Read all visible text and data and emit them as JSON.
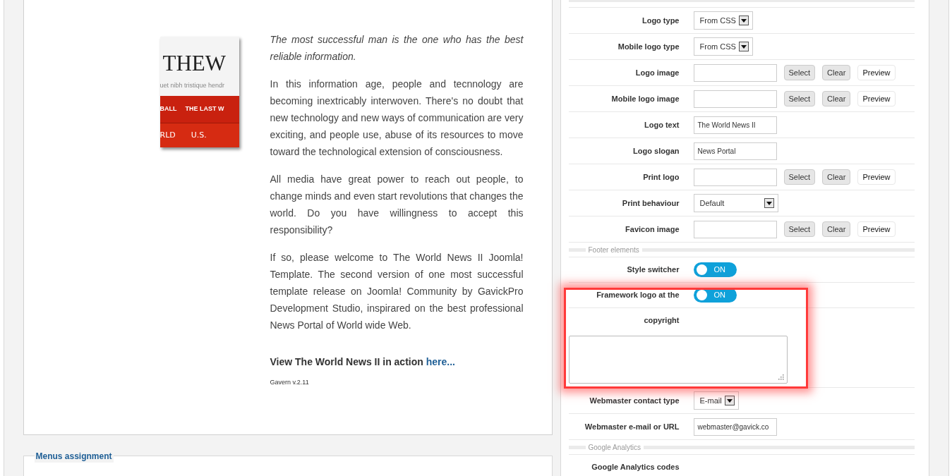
{
  "article": {
    "preview": {
      "logo": "THEW",
      "tagline": "uet nibh tristique hendr",
      "nav": [
        "BALL",
        "THE LAST W"
      ],
      "tabs": [
        "RLD",
        "U.S."
      ]
    },
    "paragraphs": [
      {
        "kind": "quote",
        "text": "The most successful man is the one who has the best reliable information."
      },
      {
        "kind": "body",
        "text": "In this information age, people and tecnnology are becoming inextricably interwoven. There's no doubt that new technology and new ways of communication are very exciting, and people use, abuse of its resources to move toward the technological extension of consciousness."
      },
      {
        "kind": "body",
        "text": "All media have great power to reach out people, to change minds and even start revolutions that changes the world. Do you have willingness to accept this responsibility?"
      },
      {
        "kind": "body",
        "text": "If so, please welcome to The World News II Joomla! Template. The second version of one most successful template release on Joomla! Community by GavickPro Development Studio, inspirared on the best professional News Portal of World wide Web."
      }
    ],
    "cta": "View The World News II in action",
    "cta_link": "here...",
    "version": "Gavern v.2.11"
  },
  "menus_legend": "Menus assignment",
  "settings": [
    {
      "kind": "legend"
    },
    {
      "kind": "select",
      "label": "Logo type",
      "value": "From CSS"
    },
    {
      "kind": "select",
      "label": "Mobile logo type",
      "value": "From CSS"
    },
    {
      "kind": "file",
      "label": "Logo image",
      "buttons": [
        "Select",
        "Clear",
        "Preview"
      ]
    },
    {
      "kind": "file",
      "label": "Mobile logo image",
      "buttons": [
        "Select",
        "Clear",
        "Preview"
      ]
    },
    {
      "kind": "text",
      "label": "Logo text",
      "value": "The World News II"
    },
    {
      "kind": "text",
      "label": "Logo slogan",
      "value": "News Portal"
    },
    {
      "kind": "file",
      "label": "Print logo",
      "buttons": [
        "Select",
        "Clear",
        "Preview"
      ]
    },
    {
      "kind": "wideselect",
      "label": "Print behaviour",
      "value": "Default"
    },
    {
      "kind": "file",
      "label": "Favicon image",
      "buttons": [
        "Select",
        "Clear",
        "Preview"
      ]
    },
    {
      "kind": "legend",
      "label": "Footer elements"
    },
    {
      "kind": "toggle",
      "label": "Style switcher",
      "on": true,
      "state": "ON"
    },
    {
      "kind": "toggle",
      "label": "Framework logo at the",
      "on": true,
      "state": "ON",
      "highlighted": true
    },
    {
      "kind": "label",
      "label": "copyright",
      "highlighted": true
    },
    {
      "kind": "textarea",
      "highlighted": true
    },
    {
      "kind": "select",
      "label": "Webmaster contact type",
      "value": "E-mail"
    },
    {
      "kind": "text",
      "label": "Webmaster e-mail or URL",
      "value": "webmaster@gavick.co"
    },
    {
      "kind": "legend",
      "label": "Google Analytics"
    },
    {
      "kind": "label",
      "label": "Google Analytics codes"
    }
  ]
}
